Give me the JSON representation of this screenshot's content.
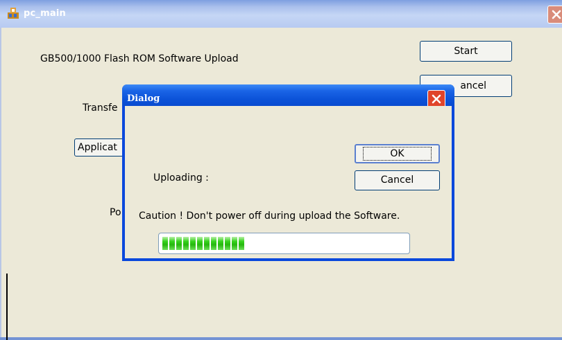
{
  "window": {
    "title": "pc_main",
    "flash_title": "GB500/1000 Flash ROM Software Upload",
    "transfer_label": "Transfe",
    "port_label": "Po",
    "start_label": "Start",
    "cancel_label": "ancel",
    "app_button_label": "Applicat"
  },
  "dialog": {
    "title": "Dialog",
    "ok_label": "OK",
    "cancel_label": "Cancel",
    "uploading_label": "Uploading :",
    "caution": "Caution ! Don't power off during upload the Software.",
    "progress_fraction": 0.33,
    "progress_color": "#26b80e"
  },
  "colors": {
    "title_text": "#ffffff",
    "dialog_frame": "#0a48dc",
    "close_button": "#e0442a"
  },
  "icons": [
    "app-icon",
    "close-icon"
  ]
}
